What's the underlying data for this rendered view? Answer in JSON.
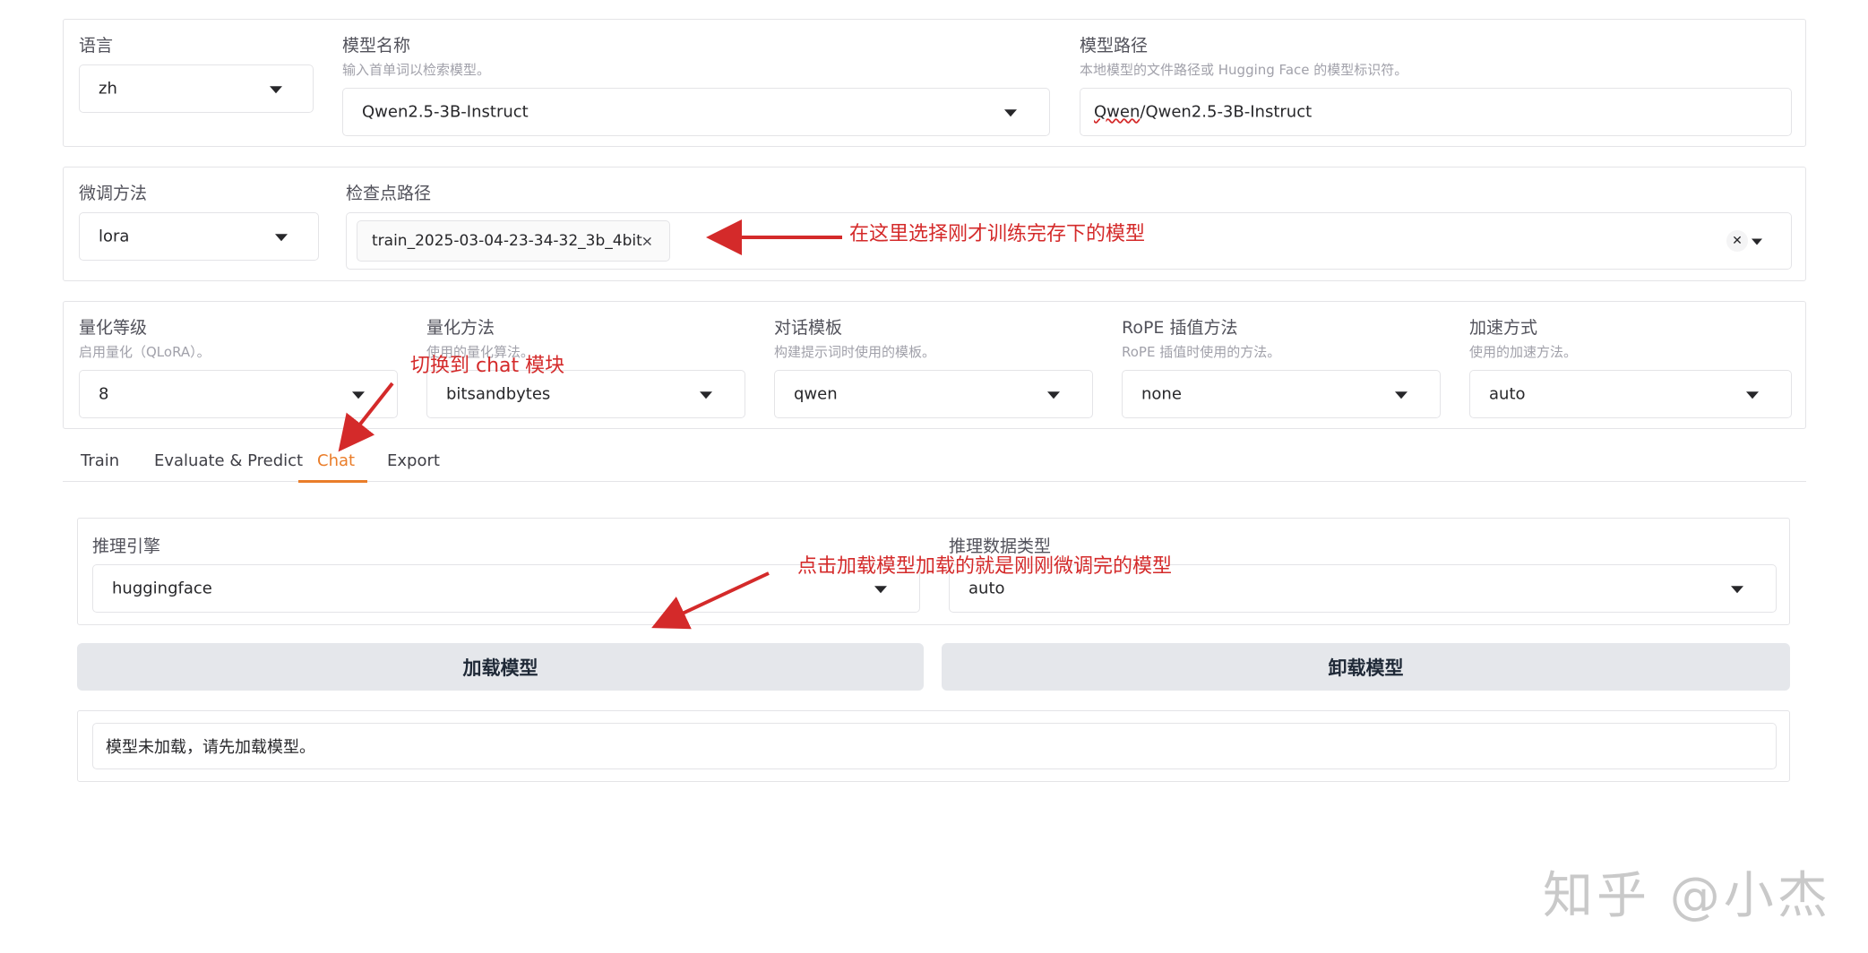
{
  "top": {
    "language": {
      "label": "语言",
      "value": "zh"
    },
    "model_name": {
      "label": "模型名称",
      "hint": "输入首单词以检索模型。",
      "value": "Qwen2.5-3B-Instruct"
    },
    "model_path": {
      "label": "模型路径",
      "hint": "本地模型的文件路径或 Hugging Face 的模型标识符。",
      "value_prefix": "Qwen",
      "value_rest": "/Qwen2.5-3B-Instruct"
    }
  },
  "finetune": {
    "method": {
      "label": "微调方法",
      "value": "lora"
    },
    "checkpoint": {
      "label": "检查点路径",
      "chip": "train_2025-03-04-23-34-32_3b_4bit",
      "chip_close": "×",
      "clear": "✕"
    }
  },
  "advanced": {
    "quant_level": {
      "label": "量化等级",
      "hint": "启用量化（QLoRA）。",
      "value": "8"
    },
    "quant_method": {
      "label": "量化方法",
      "hint": "使用的量化算法。",
      "value": "bitsandbytes"
    },
    "template": {
      "label": "对话模板",
      "hint": "构建提示词时使用的模板。",
      "value": "qwen"
    },
    "rope": {
      "label": "RoPE 插值方法",
      "hint": "RoPE 插值时使用的方法。",
      "value": "none"
    },
    "accel": {
      "label": "加速方式",
      "hint": "使用的加速方法。",
      "value": "auto"
    }
  },
  "tabs": [
    "Train",
    "Evaluate & Predict",
    "Chat",
    "Export"
  ],
  "active_tab": "Chat",
  "chat": {
    "engine": {
      "label": "推理引擎",
      "value": "huggingface"
    },
    "dtype": {
      "label": "推理数据类型",
      "value": "auto"
    },
    "load_button": "加载模型",
    "unload_button": "卸载模型",
    "status": "模型未加载，请先加载模型。"
  },
  "annotations": {
    "checkpoint_note": "在这里选择刚才训练完存下的模型",
    "tab_note": "切换到 chat 模块",
    "load_note": "点击加载模型加载的就是刚刚微调完的模型"
  },
  "watermark": "知乎 @小杰",
  "colors": {
    "accent_tab": "#ea7d2a",
    "annotation": "#d42a2a",
    "button_bg": "#e5e7eb"
  }
}
